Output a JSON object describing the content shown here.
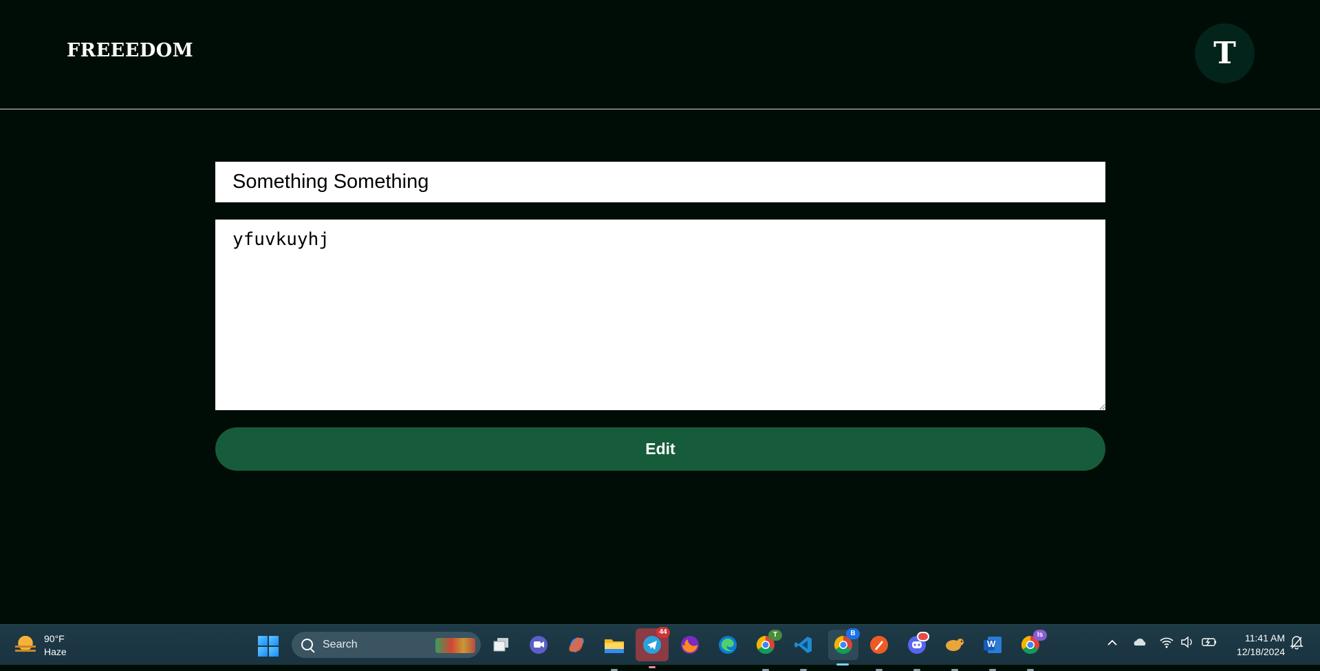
{
  "app": {
    "brand": "FREEEDOM",
    "avatar_initial": "T"
  },
  "form": {
    "title_value": "Something Something",
    "body_value": "yfuvkuyhj",
    "submit_label": "Edit"
  },
  "taskbar": {
    "weather": {
      "temp": "90°F",
      "condition": "Haze"
    },
    "search_placeholder": "Search",
    "apps": [
      {
        "name": "task-view-icon"
      },
      {
        "name": "teams-chat-icon"
      },
      {
        "name": "copilot-icon"
      },
      {
        "name": "file-explorer-icon"
      },
      {
        "name": "telegram-icon",
        "badge": "44"
      },
      {
        "name": "firefox-icon"
      },
      {
        "name": "edge-icon"
      },
      {
        "name": "chrome-profile-t-icon",
        "badge": "T"
      },
      {
        "name": "vscode-icon"
      },
      {
        "name": "chrome-profile-b-icon",
        "badge": "B"
      },
      {
        "name": "postman-icon"
      },
      {
        "name": "discord-icon"
      },
      {
        "name": "dbeaver-icon"
      },
      {
        "name": "word-icon",
        "label": "W"
      },
      {
        "name": "chrome-profile-is-icon",
        "badge": "Is"
      }
    ],
    "time": "11:41 AM",
    "date": "12/18/2024"
  },
  "colors": {
    "page_bg": "#000d06",
    "avatar_bg": "#03241a",
    "button_bg": "#175c3a",
    "taskbar_bg": "#1d3a46"
  }
}
